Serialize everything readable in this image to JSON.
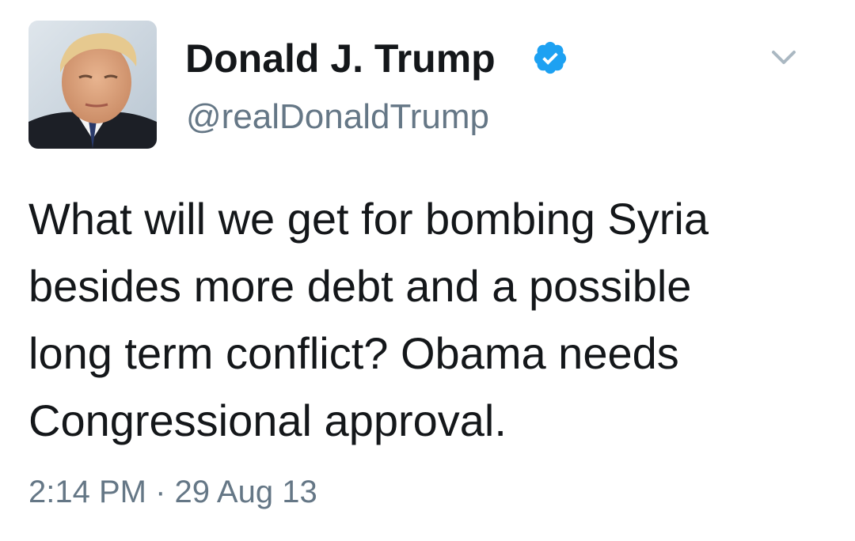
{
  "tweet": {
    "display_name": "Donald J. Trump",
    "handle": "@realDonaldTrump",
    "text": "What will we get for bombing Syria\nbesides more debt and a possible\nlong term conflict? Obama needs\nCongressional approval.",
    "timestamp": "2:14 PM · 29 Aug 13",
    "verified": true,
    "icons": {
      "verified": "verified-badge-icon",
      "menu": "chevron-down-icon"
    }
  },
  "colors": {
    "verified_blue": "#1da1f2",
    "secondary_text": "#657786",
    "primary_text": "#14171a"
  }
}
